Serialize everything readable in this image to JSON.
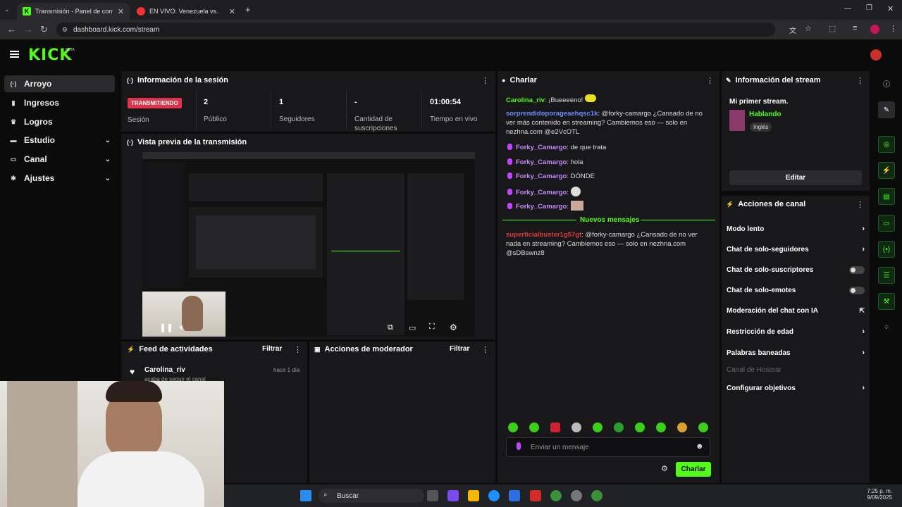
{
  "browser": {
    "tabs": [
      {
        "title": "Transmisión - Panel de control",
        "active": true
      },
      {
        "title": "EN VIVO: Venezuela vs. Col",
        "active": false
      }
    ],
    "url": "dashboard.kick.com/stream"
  },
  "header": {
    "logo": "KICK",
    "beta": "BETA"
  },
  "sidebar": {
    "items": [
      {
        "label": "Arroyo",
        "icon": "stream-icon",
        "selected": true
      },
      {
        "label": "Ingresos",
        "icon": "chart-icon"
      },
      {
        "label": "Logros",
        "icon": "trophy-icon"
      },
      {
        "label": "Estudio",
        "icon": "studio-icon",
        "expandable": true
      },
      {
        "label": "Canal",
        "icon": "channel-icon",
        "expandable": true
      },
      {
        "label": "Ajustes",
        "icon": "gear-icon",
        "expandable": true
      }
    ]
  },
  "session": {
    "title": "Información de la sesión",
    "status_badge": "TRANSMITIENDO",
    "status_label": "Sesión",
    "stats": [
      {
        "value": "2",
        "label": "Público"
      },
      {
        "value": "1",
        "label": "Seguidores"
      },
      {
        "value": "-",
        "label": "Cantidad de suscripciones"
      },
      {
        "value": "01:00:54",
        "label": "Tiempo en vivo"
      }
    ]
  },
  "preview": {
    "title": "Vista previa de la transmisión"
  },
  "activity": {
    "title": "Feed de actividades",
    "filter": "Filtrar",
    "items": [
      {
        "user": "Carolina_riv",
        "time": "hace 1 día",
        "text": "acaba de seguir el canal"
      }
    ]
  },
  "moderator": {
    "title": "Acciones de moderador",
    "filter": "Filtrar"
  },
  "chat": {
    "title": "Charlar",
    "messages": [
      {
        "user": "Carolina_riv",
        "text": ": ¡Bueeeeno!",
        "color": "green"
      },
      {
        "user": "sorprendidoporageaehqsc1k",
        "text": ": @forky-camargo ¿Cansado de no ver más contenido en streaming? Cambiemos eso — solo en nezhna.com @e2VcOTL",
        "color": "blue"
      },
      {
        "user": "Forky_Camargo",
        "text": ": de que trata",
        "color": "purple",
        "mic": true
      },
      {
        "user": "Forky_Camargo",
        "text": ": hola",
        "color": "purple",
        "mic": true
      },
      {
        "user": "Forky_Camargo",
        "text": ": DÓNDE",
        "color": "purple",
        "mic": true
      },
      {
        "user": "Forky_Camargo",
        "text": ":",
        "color": "purple",
        "mic": true
      },
      {
        "user": "Forky_Camargo",
        "text": ":",
        "color": "purple",
        "mic": true
      }
    ],
    "new_messages_label": "Nuevos mensajes",
    "new_message": {
      "user": "superficialbuster1g57gt",
      "text": ": @forky-camargo ¿Cansado de no ver nada en streaming? Cambiemos eso — solo en nezhna.com @sDBswnz8"
    },
    "input_placeholder": "Enviar un mensaje",
    "send_label": "Charlar"
  },
  "stream_info": {
    "title": "Información del stream",
    "stream_title": "Mi primer stream.",
    "category": "Hablando",
    "language": "Inglés",
    "edit_label": "Editar"
  },
  "channel_actions": {
    "title": "Acciones de canal",
    "items": [
      {
        "label": "Modo lento",
        "kind": "arrow"
      },
      {
        "label": "Chat de solo-seguidores",
        "kind": "arrow"
      },
      {
        "label": "Chat de solo-suscriptores",
        "kind": "toggle"
      },
      {
        "label": "Chat de solo-emotes",
        "kind": "toggle"
      },
      {
        "label": "Moderación del chat con IA",
        "kind": "external"
      },
      {
        "label": "Restricción de edad",
        "kind": "arrow"
      },
      {
        "label": "Palabras baneadas",
        "kind": "arrow"
      },
      {
        "label": "Canal de Hostear",
        "kind": "disabled"
      },
      {
        "label": "Configurar objetivos",
        "kind": "arrow"
      }
    ]
  },
  "taskbar": {
    "search": "Buscar",
    "time": "7:25 p. m.",
    "date": "9/09/2025"
  },
  "colors": {
    "brand": "#53fc18",
    "live": "#e0334b",
    "panel": "#18181b",
    "bg": "#0b0b0c"
  }
}
